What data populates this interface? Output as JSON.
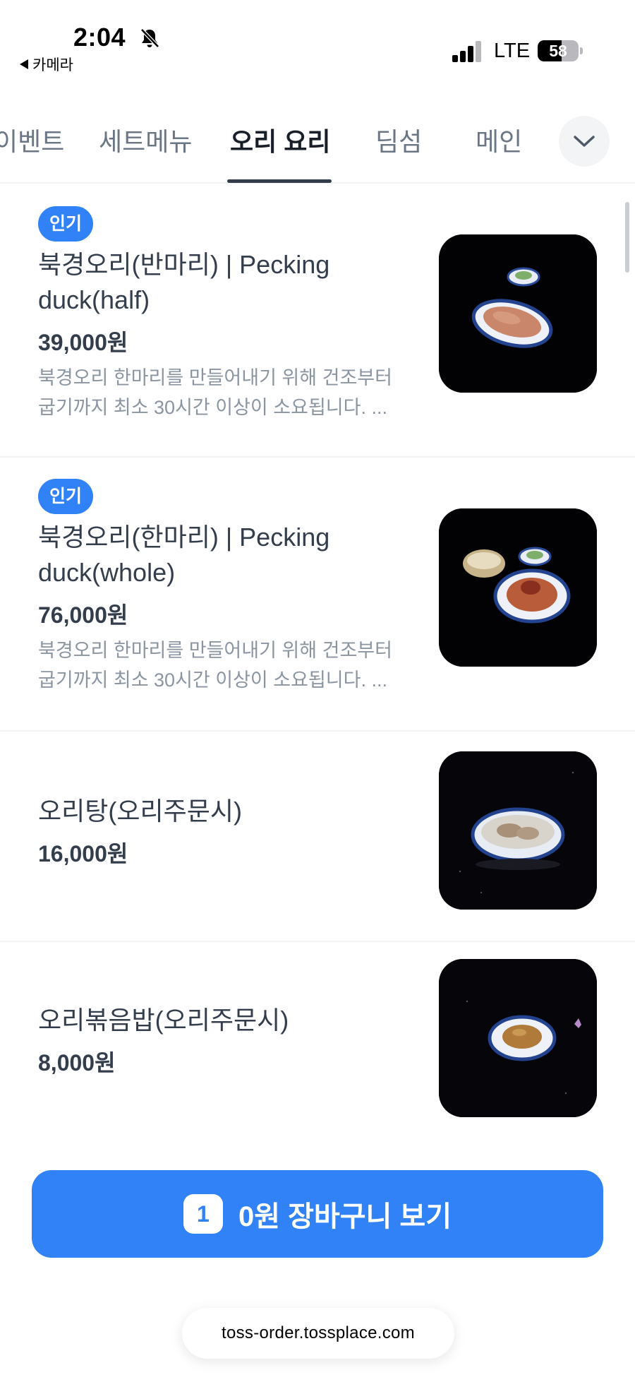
{
  "status_bar": {
    "time": "2:04",
    "back_app": "카메라",
    "network": "LTE",
    "battery": "58",
    "battery_level": 0.58
  },
  "tabs": [
    {
      "label": "이벤트",
      "active": false
    },
    {
      "label": "세트메뉴",
      "active": false
    },
    {
      "label": "오리 요리",
      "active": true
    },
    {
      "label": "딤섬",
      "active": false
    },
    {
      "label": "메인",
      "active": false
    }
  ],
  "menu_items": [
    {
      "badge": "인기",
      "name": "북경오리(반마리) | Pecking duck(half)",
      "price": "39,000원",
      "description": "북경오리 한마리를 만들어내기 위해 건조부터 굽기까지 최소 30시간 이상이 소요됩니다. ..."
    },
    {
      "badge": "인기",
      "name": "북경오리(한마리) | Pecking duck(whole)",
      "price": "76,000원",
      "description": "북경오리 한마리를 만들어내기 위해 건조부터 굽기까지 최소 30시간 이상이 소요됩니다. ..."
    },
    {
      "name": "오리탕(오리주문시)",
      "price": "16,000원"
    },
    {
      "name": "오리볶음밥(오리주문시)",
      "price": "8,000원"
    }
  ],
  "cart": {
    "count": "1",
    "label": "0원 장바구니 보기"
  },
  "url_bar": {
    "url": "toss-order.tossplace.com"
  },
  "icons": {
    "bell": "bell-slash-icon",
    "back": "back-triangle-icon",
    "signal": "cellular-signal-icon",
    "battery": "battery-icon",
    "more": "chevron-down-icon"
  },
  "colors": {
    "accent": "#3182f6",
    "text_primary": "#333d4b",
    "text_secondary": "#8b95a1",
    "tab_inactive": "#6b7684"
  }
}
